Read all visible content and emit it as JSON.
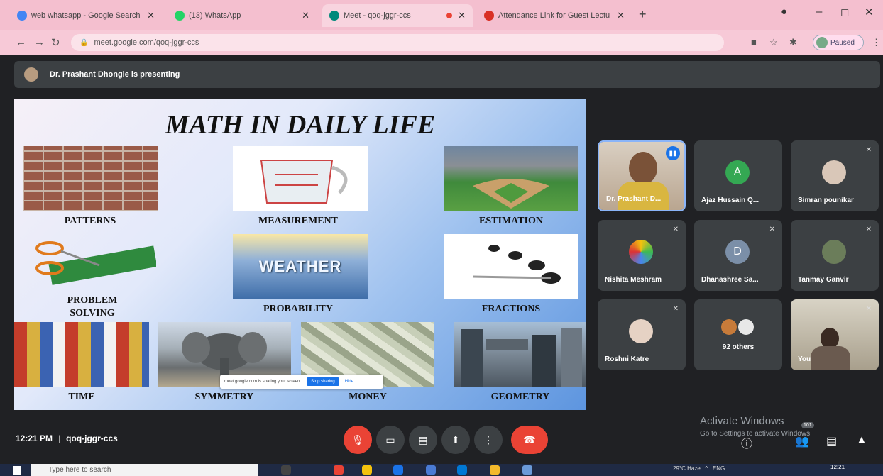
{
  "browser": {
    "tabs": [
      {
        "label": "web whatsapp - Google Search",
        "icon": "google-icon",
        "color": "#4285f4"
      },
      {
        "label": "(13) WhatsApp",
        "icon": "whatsapp-icon",
        "color": "#25d366"
      },
      {
        "label": "Meet - qoq-jggr-ccs",
        "icon": "meet-icon",
        "color": "#00897b",
        "active": true
      },
      {
        "label": "Attendance Link for Guest Lectu",
        "icon": "gmail-icon",
        "color": "#d93025"
      }
    ],
    "url": "meet.google.com/qoq-jggr-ccs",
    "profile_label": "Paused"
  },
  "meet": {
    "presenting_text": "Dr. Prashant Dhongle is presenting",
    "slide": {
      "title": "MATH IN DAILY LIFE",
      "captions": {
        "patterns": "PATTERNS",
        "measurement": "MEASUREMENT",
        "estimation": "ESTIMATION",
        "problem": "PROBLEM",
        "solving": "SOLVING",
        "probability": "PROBABILITY",
        "fractions": "FRACTIONS",
        "time": "TIME",
        "symmetry": "SYMMETRY",
        "money": "MONEY",
        "geometry": "GEOMETRY"
      },
      "weather_text": "WEATHER",
      "share_banner": {
        "text": "meet.google.com is sharing your screen.",
        "stop_label": "Stop sharing",
        "hide_label": "Hide"
      }
    },
    "participants": [
      {
        "name": "Dr. Prashant D...",
        "type": "video",
        "speaking": true
      },
      {
        "name": "Ajaz Hussain Q...",
        "initial": "A",
        "avatar_color": "#34a853",
        "muted": false
      },
      {
        "name": "Simran pounikar",
        "muted": true
      },
      {
        "name": "Nishita Meshram",
        "muted": true
      },
      {
        "name": "Dhanashree Sa...",
        "initial": "D",
        "avatar_color": "#7b8fa8",
        "muted": true
      },
      {
        "name": "Tanmay Ganvir",
        "muted": true
      },
      {
        "name": "Roshni Katre",
        "muted": true
      },
      {
        "name": "92 others"
      },
      {
        "name": "You",
        "type": "video",
        "muted": true
      }
    ],
    "time": "12:21 PM",
    "meeting_code": "qoq-jggr-ccs",
    "participant_count": "101",
    "activate_title": "Activate Windows",
    "activate_sub": "Go to Settings to activate Windows."
  },
  "taskbar": {
    "search_placeholder": "Type here to search",
    "tray": "29°C Haze",
    "lang": "ENG",
    "clock": "12:21"
  }
}
